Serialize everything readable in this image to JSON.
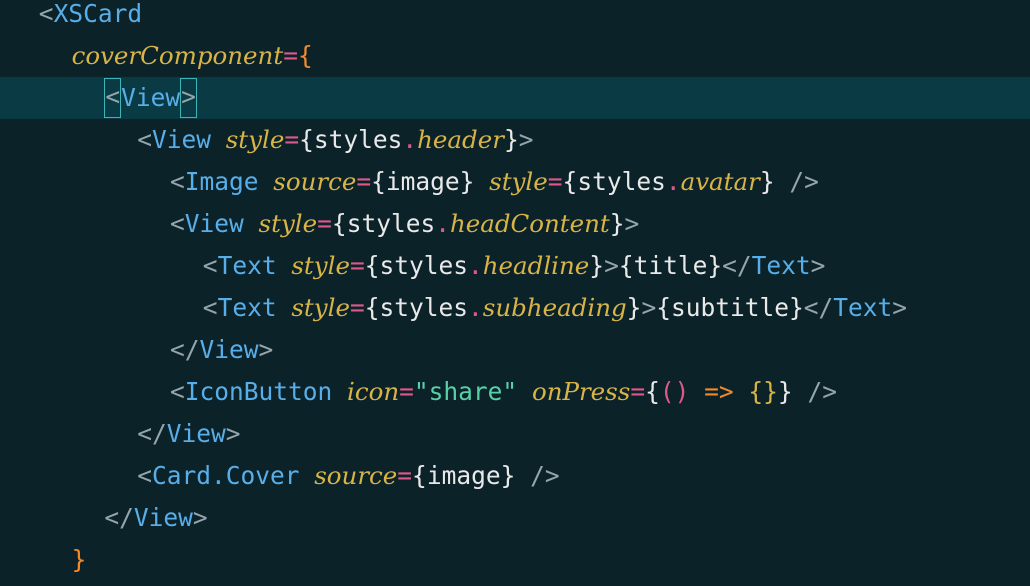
{
  "editor": {
    "lines": [
      {
        "indent": "  ",
        "tokens": [
          {
            "t": "punct",
            "v": "<"
          },
          {
            "t": "tag",
            "v": "XSCard"
          }
        ]
      },
      {
        "indent": "    ",
        "tokens": [
          {
            "t": "attr",
            "v": "coverComponent"
          },
          {
            "t": "eq",
            "v": "="
          },
          {
            "t": "brace-orange",
            "v": "{"
          }
        ]
      },
      {
        "indent": "      ",
        "active": true,
        "tokens": [
          {
            "t": "punct",
            "v": "<",
            "match": true
          },
          {
            "t": "tag",
            "v": "View"
          },
          {
            "t": "punct",
            "v": ">",
            "match": true
          }
        ]
      },
      {
        "indent": "        ",
        "tokens": [
          {
            "t": "punct",
            "v": "<"
          },
          {
            "t": "tag",
            "v": "View"
          },
          {
            "t": "ident",
            "v": " "
          },
          {
            "t": "attr",
            "v": "style"
          },
          {
            "t": "eq",
            "v": "="
          },
          {
            "t": "brace",
            "v": "{"
          },
          {
            "t": "ident",
            "v": "styles"
          },
          {
            "t": "dot",
            "v": "."
          },
          {
            "t": "prop",
            "v": "header"
          },
          {
            "t": "brace",
            "v": "}"
          },
          {
            "t": "punct",
            "v": ">"
          }
        ]
      },
      {
        "indent": "          ",
        "tokens": [
          {
            "t": "punct",
            "v": "<"
          },
          {
            "t": "tag",
            "v": "Image"
          },
          {
            "t": "ident",
            "v": " "
          },
          {
            "t": "attr",
            "v": "source"
          },
          {
            "t": "eq",
            "v": "="
          },
          {
            "t": "brace",
            "v": "{"
          },
          {
            "t": "ident",
            "v": "image"
          },
          {
            "t": "brace",
            "v": "}"
          },
          {
            "t": "ident",
            "v": " "
          },
          {
            "t": "attr",
            "v": "style"
          },
          {
            "t": "eq",
            "v": "="
          },
          {
            "t": "brace",
            "v": "{"
          },
          {
            "t": "ident",
            "v": "styles"
          },
          {
            "t": "dot",
            "v": "."
          },
          {
            "t": "prop",
            "v": "avatar"
          },
          {
            "t": "brace",
            "v": "}"
          },
          {
            "t": "ident",
            "v": " "
          },
          {
            "t": "punct",
            "v": "/>"
          }
        ]
      },
      {
        "indent": "          ",
        "tokens": [
          {
            "t": "punct",
            "v": "<"
          },
          {
            "t": "tag",
            "v": "View"
          },
          {
            "t": "ident",
            "v": " "
          },
          {
            "t": "attr",
            "v": "style"
          },
          {
            "t": "eq",
            "v": "="
          },
          {
            "t": "brace",
            "v": "{"
          },
          {
            "t": "ident",
            "v": "styles"
          },
          {
            "t": "dot",
            "v": "."
          },
          {
            "t": "prop",
            "v": "headContent"
          },
          {
            "t": "brace",
            "v": "}"
          },
          {
            "t": "punct",
            "v": ">"
          }
        ]
      },
      {
        "indent": "            ",
        "tokens": [
          {
            "t": "punct",
            "v": "<"
          },
          {
            "t": "tag",
            "v": "Text"
          },
          {
            "t": "ident",
            "v": " "
          },
          {
            "t": "attr",
            "v": "style"
          },
          {
            "t": "eq",
            "v": "="
          },
          {
            "t": "brace",
            "v": "{"
          },
          {
            "t": "ident",
            "v": "styles"
          },
          {
            "t": "dot",
            "v": "."
          },
          {
            "t": "prop",
            "v": "headline"
          },
          {
            "t": "brace",
            "v": "}"
          },
          {
            "t": "punct",
            "v": ">"
          },
          {
            "t": "brace",
            "v": "{"
          },
          {
            "t": "ident",
            "v": "title"
          },
          {
            "t": "brace",
            "v": "}"
          },
          {
            "t": "punct",
            "v": "</"
          },
          {
            "t": "tag",
            "v": "Text"
          },
          {
            "t": "punct",
            "v": ">"
          }
        ]
      },
      {
        "indent": "            ",
        "tokens": [
          {
            "t": "punct",
            "v": "<"
          },
          {
            "t": "tag",
            "v": "Text"
          },
          {
            "t": "ident",
            "v": " "
          },
          {
            "t": "attr",
            "v": "style"
          },
          {
            "t": "eq",
            "v": "="
          },
          {
            "t": "brace",
            "v": "{"
          },
          {
            "t": "ident",
            "v": "styles"
          },
          {
            "t": "dot",
            "v": "."
          },
          {
            "t": "prop",
            "v": "subheading"
          },
          {
            "t": "brace",
            "v": "}"
          },
          {
            "t": "punct",
            "v": ">"
          },
          {
            "t": "brace",
            "v": "{"
          },
          {
            "t": "ident",
            "v": "subtitle"
          },
          {
            "t": "brace",
            "v": "}"
          },
          {
            "t": "punct",
            "v": "</"
          },
          {
            "t": "tag",
            "v": "Text"
          },
          {
            "t": "punct",
            "v": ">"
          }
        ]
      },
      {
        "indent": "          ",
        "tokens": [
          {
            "t": "punct",
            "v": "</"
          },
          {
            "t": "tag",
            "v": "View"
          },
          {
            "t": "punct",
            "v": ">"
          }
        ]
      },
      {
        "indent": "          ",
        "tokens": [
          {
            "t": "punct",
            "v": "<"
          },
          {
            "t": "tag",
            "v": "IconButton"
          },
          {
            "t": "ident",
            "v": " "
          },
          {
            "t": "attr",
            "v": "icon"
          },
          {
            "t": "eq",
            "v": "="
          },
          {
            "t": "string",
            "v": "\"share\""
          },
          {
            "t": "ident",
            "v": " "
          },
          {
            "t": "attr",
            "v": "onPress"
          },
          {
            "t": "eq",
            "v": "="
          },
          {
            "t": "brace",
            "v": "{"
          },
          {
            "t": "paren",
            "v": "()"
          },
          {
            "t": "ident",
            "v": " "
          },
          {
            "t": "arrow",
            "v": "=>"
          },
          {
            "t": "ident",
            "v": " "
          },
          {
            "t": "brace-yellow",
            "v": "{}"
          },
          {
            "t": "brace",
            "v": "}"
          },
          {
            "t": "ident",
            "v": " "
          },
          {
            "t": "punct",
            "v": "/>"
          }
        ]
      },
      {
        "indent": "        ",
        "tokens": [
          {
            "t": "punct",
            "v": "</"
          },
          {
            "t": "tag",
            "v": "View"
          },
          {
            "t": "punct",
            "v": ">"
          }
        ]
      },
      {
        "indent": "        ",
        "tokens": [
          {
            "t": "punct",
            "v": "<"
          },
          {
            "t": "tag",
            "v": "Card.Cover"
          },
          {
            "t": "ident",
            "v": " "
          },
          {
            "t": "attr",
            "v": "source"
          },
          {
            "t": "eq",
            "v": "="
          },
          {
            "t": "brace",
            "v": "{"
          },
          {
            "t": "ident",
            "v": "image"
          },
          {
            "t": "brace",
            "v": "}"
          },
          {
            "t": "ident",
            "v": " "
          },
          {
            "t": "punct",
            "v": "/>"
          }
        ]
      },
      {
        "indent": "      ",
        "tokens": [
          {
            "t": "punct",
            "v": "</"
          },
          {
            "t": "tag",
            "v": "View"
          },
          {
            "t": "punct",
            "v": ">"
          }
        ]
      },
      {
        "indent": "    ",
        "tokens": [
          {
            "t": "brace-orange",
            "v": "}"
          }
        ]
      }
    ]
  },
  "colors": {
    "background": "#0c2229",
    "active_line": "#0a3a44",
    "tag": "#58aee8",
    "attribute": "#d8b447",
    "operator": "#e0588a",
    "string": "#58d0a8",
    "bracket_match_border": "#3bb5b8"
  }
}
